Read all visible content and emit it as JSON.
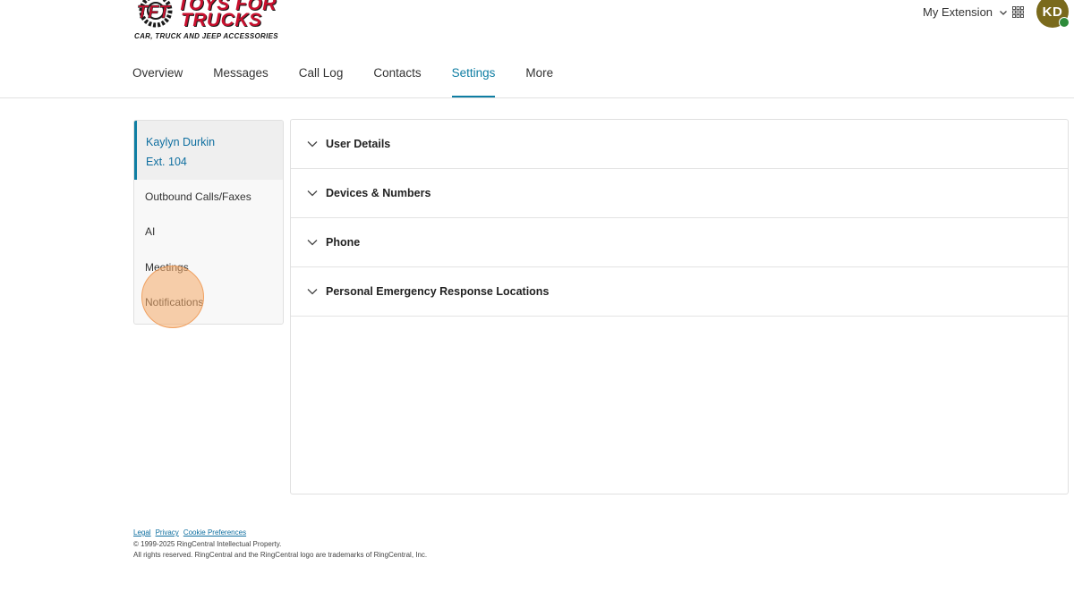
{
  "header": {
    "logo": {
      "line1": "TOYS FOR",
      "line2": "TRUCKS",
      "tagline": "CAR, TRUCK AND JEEP ACCESSORIES",
      "mark": "TFT"
    },
    "extension_selector": "My Extension",
    "avatar_initials": "KD",
    "presence_color": "#2e8b3a",
    "accent_color": "#0f7ea3",
    "icons": {
      "selector": "chevron-down-icon",
      "apps": "apps-grid-icon"
    }
  },
  "nav": {
    "tabs": [
      {
        "label": "Overview",
        "active": false
      },
      {
        "label": "Messages",
        "active": false
      },
      {
        "label": "Call Log",
        "active": false
      },
      {
        "label": "Contacts",
        "active": false
      },
      {
        "label": "Settings",
        "active": true
      },
      {
        "label": "More",
        "active": false
      }
    ]
  },
  "sidebar": {
    "user_name": "Kaylyn Durkin",
    "user_ext": "Ext. 104",
    "items": [
      {
        "label": "Outbound Calls/Faxes"
      },
      {
        "label": "AI"
      },
      {
        "label": "Meetings"
      },
      {
        "label": "Notifications"
      }
    ]
  },
  "main": {
    "sections": [
      {
        "label": "User Details"
      },
      {
        "label": "Devices & Numbers"
      },
      {
        "label": "Phone"
      },
      {
        "label": "Personal Emergency Response Locations"
      }
    ]
  },
  "footer": {
    "links": [
      "Legal",
      "Privacy",
      "Cookie Preferences"
    ],
    "copyright": "© 1999-2025 RingCentral Intellectual Property.",
    "rights": "All rights reserved. RingCentral and the RingCentral logo are trademarks of RingCentral, Inc."
  }
}
